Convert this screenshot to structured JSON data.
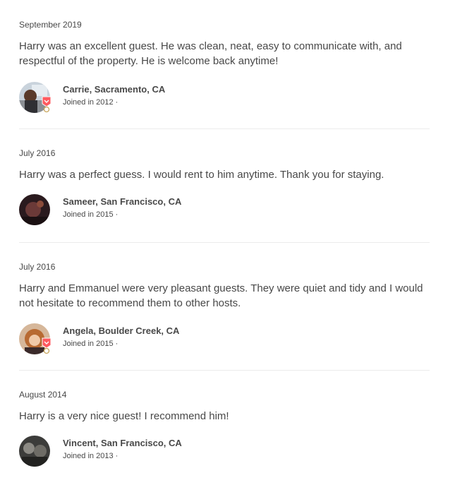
{
  "reviews": [
    {
      "date": "September 2019",
      "text": "Harry was an excellent guest. He was clean, neat, easy to communicate with, and respectful of the property. He is welcome back anytime!",
      "reviewer_name": "Carrie, Sacramento, CA",
      "joined": "Joined in 2012 ·",
      "avatar_icon": "avatar-photo-icon",
      "superhost": true
    },
    {
      "date": "July 2016",
      "text": "Harry was a perfect guess. I would rent to him anytime. Thank you for staying.",
      "reviewer_name": "Sameer, San Francisco, CA",
      "joined": "Joined in 2015 ·",
      "avatar_icon": "avatar-photo-icon",
      "superhost": false
    },
    {
      "date": "July 2016",
      "text": "Harry and Emmanuel were very pleasant guests. They were quiet and tidy and I would not hesitate to recommend them to other hosts.",
      "reviewer_name": "Angela, Boulder Creek, CA",
      "joined": "Joined in 2015 ·",
      "avatar_icon": "avatar-photo-icon",
      "superhost": true
    },
    {
      "date": "August 2014",
      "text": "Harry is a very nice guest! I recommend him!",
      "reviewer_name": "Vincent, San Francisco, CA",
      "joined": "Joined in 2013 ·",
      "avatar_icon": "avatar-photo-icon",
      "superhost": false
    }
  ],
  "colors": {
    "text": "#484848",
    "divider": "#ebebeb",
    "superhost_badge": "#ff5a5f"
  }
}
